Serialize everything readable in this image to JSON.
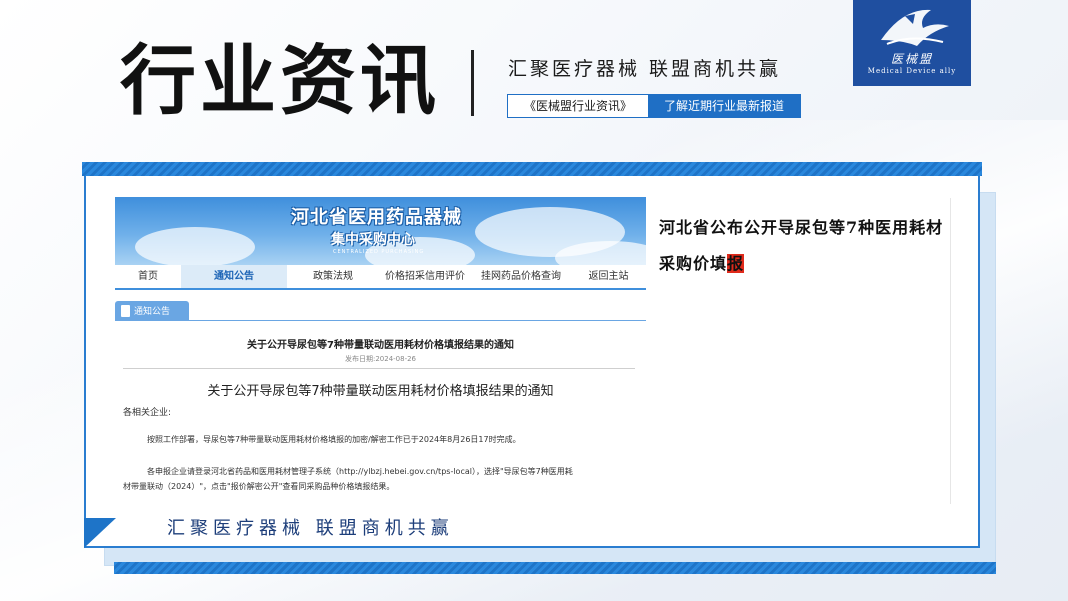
{
  "header": {
    "title": "行业资讯",
    "slogan": "汇聚医疗器械  联盟商机共赢",
    "tag_left": "《医械盟行业资讯》",
    "tag_right": "了解近期行业最新报道"
  },
  "logo": {
    "cn": "医械盟",
    "en": "Medical Device ally"
  },
  "colors": {
    "accent": "#1f6fc5",
    "logo_bg": "#1f4fa0",
    "highlight": "#e02a1b"
  },
  "site": {
    "name": "河北省医用药品器械",
    "sub": "集中采购中心",
    "sub_en": "CENTRALIZED PURCHASING",
    "nav": [
      "首页",
      "通知公告",
      "政策法规",
      "价格招采信用评价",
      "挂网药品价格查询",
      "返回主站"
    ],
    "section_label": "通知公告"
  },
  "notice": {
    "title_small": "关于公开导尿包等7种带量联动医用耗材价格填报结果的通知",
    "date": "发布日期:2024-08-26",
    "title_big": "关于公开导尿包等7种带量联动医用耗材价格填报结果的通知",
    "salutation": "各相关企业:",
    "p1": "按照工作部署，导尿包等7种带量联动医用耗材价格填报的加密/解密工作已于2024年8月26日17时完成。",
    "p2a": "各申报企业请登录河北省药品和医用耗材管理子系统（http://ylbzj.hebei.gov.cn/tps-local），选择\"导尿包等7种医用耗",
    "p2b": "材带量联动（2024）\"，点击\"报价解密公开\"查看同采购品种价格填报结果。"
  },
  "headline": {
    "text": "河北省公布公开导尿包等7种医用耗材采购价填",
    "highlight": "报"
  },
  "footer_slogan": "汇聚医疗器械  联盟商机共赢"
}
